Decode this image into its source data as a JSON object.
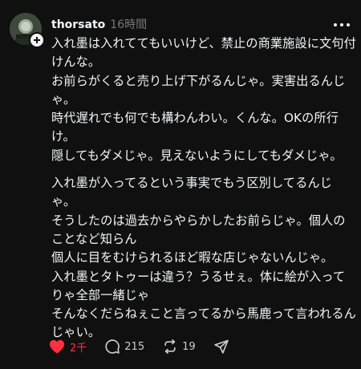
{
  "post": {
    "username": "thorsato",
    "timestamp": "16時間",
    "paragraphs": [
      [
        "入れ墨は入れててもいいけど、禁止の商業施設に文句付けんな。",
        "お前らがくると売り上げ下がるんじゃ。実害出るんじゃ。",
        "時代遅れでも何でも構わんわい。くんな。OKの所行け。",
        "隠してもダメじゃ。見えないようにしてもダメじゃ。"
      ],
      [
        "入れ墨が入ってるという事実でもう区別してるんじゃ。",
        "そうしたのは過去からやらかしたお前らじゃ。個人のことなど知らん",
        "個人に目をむけられるほど暇な店じゃないんじゃ。",
        "入れ墨とタトゥーは違う？うるせぇ。体に絵が入ってりゃ全部一緒じゃ",
        "そんなくだらねぇこと言ってるから馬鹿って言われるんじゃい。"
      ]
    ]
  },
  "actions": {
    "likes": "2千",
    "comments": "215",
    "reposts": "19"
  },
  "colors": {
    "background": "#101010",
    "text": "#f3f5f7",
    "muted": "#777777",
    "like": "#ff3040"
  },
  "icons": {
    "like": "heart-icon",
    "comment": "comment-bubble-icon",
    "repost": "repost-icon",
    "share": "send-icon",
    "follow": "plus-icon",
    "more": "more-dots-icon"
  }
}
